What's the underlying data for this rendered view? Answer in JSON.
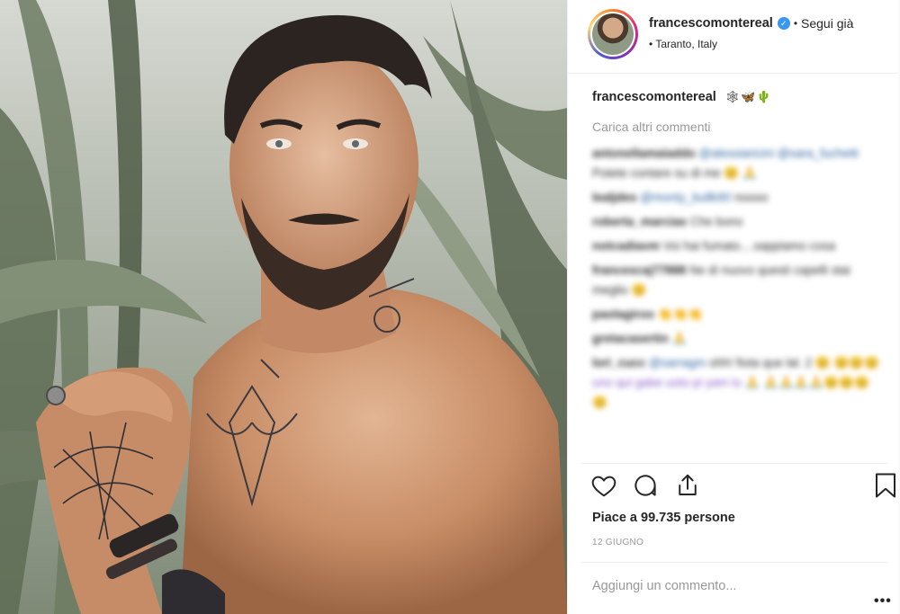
{
  "post": {
    "photo_alt": "photo",
    "username": "francescomontereal",
    "verified_icon": "verified-badge-icon",
    "separator": "•",
    "follow_label": "Segui già",
    "location": "• Taranto, Italy"
  },
  "caption": {
    "username": "francescomontereal",
    "emoji": "🕸🦋🌵"
  },
  "load_more_label": "Carica altri commenti",
  "comments": [
    {
      "user": "antonellamaiaddo",
      "mention": "@alessiaricini @sara_fucheiti",
      "text": "Potete contare su di me",
      "emoji": "😊 🙏"
    },
    {
      "user": "lealjdes",
      "mention": "@monty_bullk90",
      "text": "noooo",
      "emoji": ""
    },
    {
      "user": "roberta_marcias",
      "mention": "",
      "text": "Che bono",
      "emoji": ""
    },
    {
      "user": "notcadiavm",
      "mention": "",
      "text": "Voi hai fumato....sappiamo cosa",
      "emoji": ""
    },
    {
      "user": "francescaj77888",
      "mention": "",
      "text": "Ne di nuovo questi capelli stai meglio",
      "emoji": "😊"
    },
    {
      "user": "paolagiroo",
      "mention": "",
      "text": "",
      "emoji": "👏👏👏"
    },
    {
      "user": "gretacasertin",
      "mention": "",
      "text": "",
      "emoji": "🙏"
    },
    {
      "user": "lori_cucc",
      "mention": "@sarragm",
      "text": "ohh! fiota que lal. 2",
      "emoji": "😊 😊😊😊 uno qui gabe uoto pi yam lu 🙏 🙏🙏🙏🙏😊😊😊😊"
    }
  ],
  "actions": {
    "like_icon": "heart-icon",
    "comment_icon": "comment-icon",
    "share_icon": "share-icon",
    "save_icon": "bookmark-icon"
  },
  "likes_label": "Piace a 99.735 persone",
  "date_label": "12 GIUGNO",
  "add_comment_placeholder": "Aggiungi un commento...",
  "more_label": "•••",
  "colors": {
    "link": "#3897f0",
    "muted": "#999999",
    "text": "#262626",
    "border": "#efefef"
  }
}
